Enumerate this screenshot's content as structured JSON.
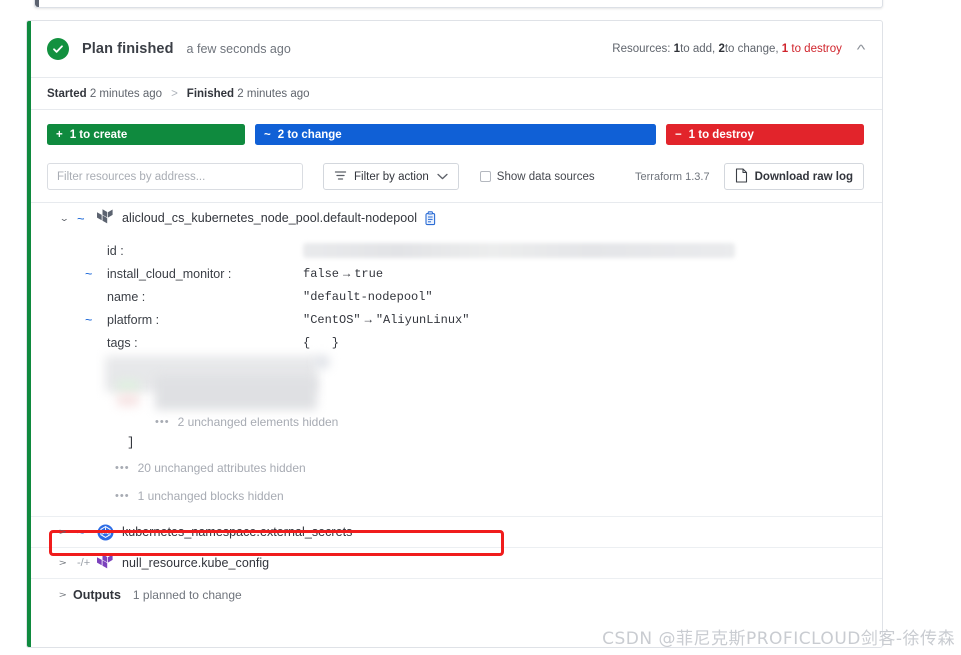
{
  "header": {
    "status_title": "Plan finished",
    "status_time": "a few seconds ago",
    "resources_label": "Resources:",
    "add_count": "1",
    "add_label": " to add,",
    "change_count": "2",
    "change_label": " to change,",
    "destroy_count": "1",
    "destroy_label": " to destroy",
    "collapse_icon": "chevron-up-icon"
  },
  "timeline": {
    "started_label": "Started",
    "started_value": "2 minutes ago",
    "separator": ">",
    "finished_label": "Finished",
    "finished_value": "2 minutes ago"
  },
  "bars": [
    {
      "symbol": "+",
      "label": "1 to create",
      "color": "#0f8a3e"
    },
    {
      "symbol": "~",
      "label": "2 to change",
      "color": "#1060d6"
    },
    {
      "symbol": "−",
      "label": "1 to destroy",
      "color": "#e2242b"
    }
  ],
  "toolbar": {
    "filter_placeholder": "Filter resources by address...",
    "filter_value": "",
    "filter_by_action_label": "Filter by action",
    "show_data_sources_label": "Show data sources",
    "show_data_sources_checked": false,
    "terraform_version": "Terraform 1.3.7",
    "download_label": "Download raw log"
  },
  "resource": {
    "twisty": "⌄",
    "change_glyph": "~",
    "provider_icon": "terraform-logo-icon",
    "address": "alicloud_cs_kubernetes_node_pool.default-nodepool",
    "copy_icon": "copy-icon",
    "attributes": [
      {
        "mark": "",
        "key": "id :",
        "value": "",
        "redacted": true
      },
      {
        "mark": "~",
        "key": "install_cloud_monitor :",
        "old": "false",
        "arrow": "→",
        "new": "true"
      },
      {
        "mark": "",
        "key": "name :",
        "value": "\"default-nodepool\""
      },
      {
        "mark": "~",
        "key": "platform :",
        "old": "\"CentOS\"",
        "arrow": "→",
        "new": "\"AliyunLinux\"",
        "highlighted": true
      },
      {
        "mark": "",
        "key": "tags :",
        "value": "{   }"
      }
    ],
    "hidden_elements_note": "2 unchanged elements hidden",
    "closing_bracket": "]",
    "hidden_attributes_note": "20 unchanged attributes hidden",
    "hidden_blocks_note": "1 unchanged blocks hidden",
    "dots": "•••"
  },
  "other_resources": [
    {
      "twisty": ">",
      "change_glyph": "~",
      "provider_icon": "kubernetes-logo-icon",
      "address": "kubernetes_namespace.external_secrets"
    },
    {
      "twisty": ">",
      "change_glyph": "-/+",
      "provider_icon": "terraform-logo-icon",
      "address": "null_resource.kube_config"
    }
  ],
  "outputs": {
    "twisty": ">",
    "label": "Outputs",
    "summary": "1 planned to change"
  },
  "watermark": "CSDN @菲尼克斯PROFICLOUD剑客-徐传森"
}
